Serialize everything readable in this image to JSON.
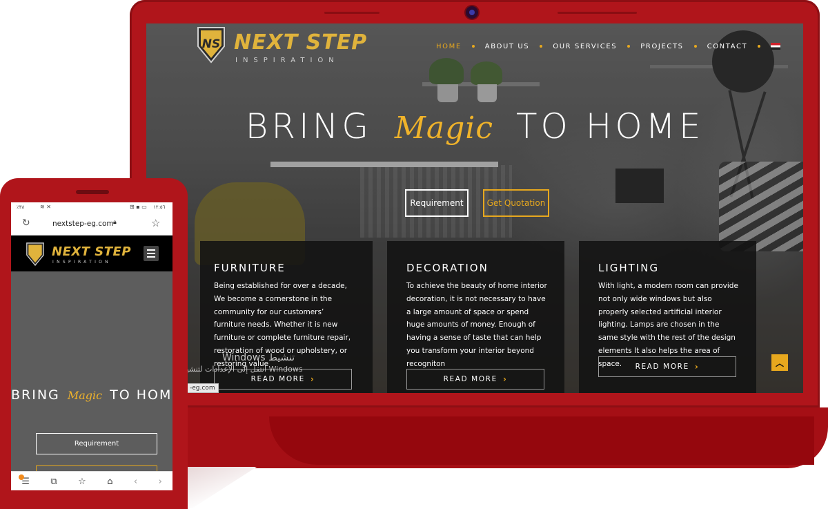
{
  "laptop_site": {
    "logo": {
      "name": "NEXT STEP",
      "tagline": "INSPIRATION",
      "monogram": "NS"
    },
    "nav": [
      {
        "label": "HOME",
        "active": true
      },
      {
        "label": "ABOUT US",
        "active": false
      },
      {
        "label": "OUR SERVICES",
        "active": false
      },
      {
        "label": "PROJECTS",
        "active": false
      },
      {
        "label": "CONTACT",
        "active": false
      }
    ],
    "language_flag_icon": "egypt-flag-icon",
    "hero": {
      "title_before": "BRING",
      "title_magic": "Magic",
      "title_after": "TO HOME"
    },
    "buttons": {
      "requirement": "Requirement",
      "quotation": "Get Quotation"
    },
    "cards": [
      {
        "title": "FURNITURE",
        "text": "Being established for over a decade, We become a cornerstone in the community for our customers’ furniture needs. Whether it is new furniture or complete furniture repair, restoration of wood or upholstery, or restoring value",
        "button": "READ MORE"
      },
      {
        "title": "DECORATION",
        "text": "To achieve the beauty of home interior decoration, it is not necessary to have a large amount of space or spend huge amounts of money. Enough of having a sense of taste that can help you transform your interior beyond recogniton",
        "button": "READ MORE"
      },
      {
        "title": "LIGHTING",
        "text": "With light, a modern room can provide not only wide windows but also properly selected artificial interior lighting. Lamps are chosen in the same style with the rest of the design elements It also helps the area of space.",
        "button": "READ MORE"
      }
    ],
    "watermark": {
      "line1": "Windows تنشيط",
      "line2": "انتقل إلى الإعدادات لتنشيط Windows"
    },
    "status_url": "-eg.com",
    "scroll_top_icon": "chevron-up-icon"
  },
  "phone": {
    "status_left": "٪٣٨",
    "status_right": "١٢:٥٦",
    "url": "nextstep-eg.com",
    "logo": {
      "name": "NEXT STEP",
      "tagline": "INSPIRATION"
    },
    "hero": {
      "title_before": "BRING",
      "title_magic": "Magic",
      "title_after": "TO HOME"
    },
    "button_requirement": "Requirement",
    "tab_count_badge": "",
    "nav_icons": [
      "menu-icon",
      "tabs-icon",
      "star-icon",
      "home-icon",
      "back-icon",
      "forward-icon"
    ]
  },
  "colors": {
    "device_red": "#b0151b",
    "accent_gold": "#e7a81e",
    "dark_panel": "#121212"
  }
}
